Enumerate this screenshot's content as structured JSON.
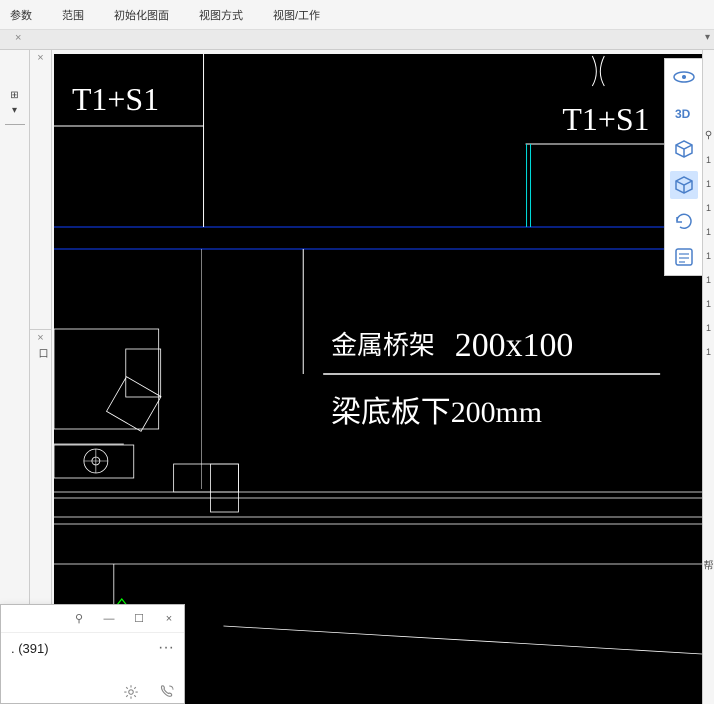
{
  "top_menu": {
    "items": [
      "参数",
      "范围",
      "初始化图面",
      "视图方式",
      "视图/工作"
    ]
  },
  "canvas": {
    "label_left": "T1+S1",
    "label_right": "T1+S1",
    "cable_tray_label": "金属桥架",
    "cable_tray_size": "200x100",
    "beam_note": "梁底板下200mm"
  },
  "view_tools": {
    "orbit": "orbit-icon",
    "v3d": "3D",
    "cube_outline": "cube-outline-icon",
    "cube_solid": "cube-solid-icon",
    "rotate": "rotate-icon",
    "properties": "properties-icon"
  },
  "popup": {
    "title_count": ". (391)",
    "more": "···"
  },
  "right_edge": {
    "pin": "📌",
    "label": "帮"
  },
  "left_panel": {
    "g1": "⊞"
  }
}
